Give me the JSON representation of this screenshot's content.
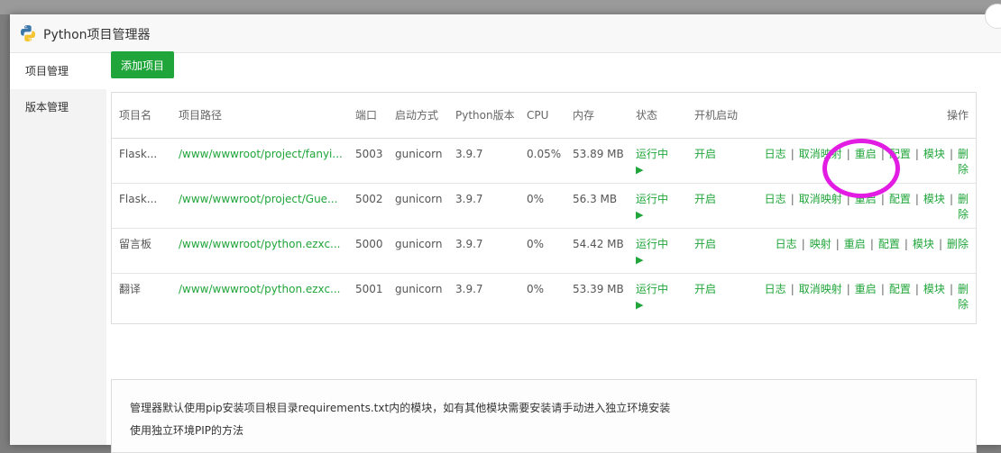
{
  "dialog": {
    "title": "Python项目管理器",
    "logo_icon": "python-logo-icon",
    "close_icon": "close-icon"
  },
  "sidebar": {
    "items": [
      {
        "label": "项目管理",
        "active": true
      },
      {
        "label": "版本管理",
        "active": false
      }
    ]
  },
  "toolbar": {
    "add_label": "添加项目"
  },
  "table": {
    "columns": [
      "项目名",
      "项目路径",
      "端口",
      "启动方式",
      "Python版本",
      "CPU",
      "内存",
      "状态",
      "开机启动",
      "操作"
    ],
    "rows": [
      {
        "name": "Flask...",
        "path": "/www/wwwroot/project/fanyi...",
        "port": "5003",
        "start": "gunicorn",
        "python": "3.9.7",
        "cpu": "0.05%",
        "mem": "53.89 MB",
        "status": "运行中",
        "status_icon": "play-icon",
        "boot": "开启",
        "actions": {
          "log": "日志",
          "map": "取消映射",
          "restart": "重启",
          "config": "配置",
          "module": "模块",
          "delete": "删除"
        }
      },
      {
        "name": "Flask...",
        "path": "/www/wwwroot/project/Gue...",
        "port": "5002",
        "start": "gunicorn",
        "python": "3.9.7",
        "cpu": "0%",
        "mem": "56.3 MB",
        "status": "运行中",
        "status_icon": "play-icon",
        "boot": "开启",
        "actions": {
          "log": "日志",
          "map": "取消映射",
          "restart": "重启",
          "config": "配置",
          "module": "模块",
          "delete": "删除"
        }
      },
      {
        "name": "留言板",
        "path": "/www/wwwroot/python.ezxc...",
        "port": "5000",
        "start": "gunicorn",
        "python": "3.9.7",
        "cpu": "0%",
        "mem": "54.42 MB",
        "status": "运行中",
        "status_icon": "play-icon",
        "boot": "开启",
        "actions": {
          "log": "日志",
          "map": "映射",
          "restart": "重启",
          "config": "配置",
          "module": "模块",
          "delete": "删除"
        }
      },
      {
        "name": "翻译",
        "path": "/www/wwwroot/python.ezxc...",
        "port": "5001",
        "start": "gunicorn",
        "python": "3.9.7",
        "cpu": "0%",
        "mem": "53.39 MB",
        "status": "运行中",
        "status_icon": "play-icon",
        "boot": "开启",
        "actions": {
          "log": "日志",
          "map": "取消映射",
          "restart": "重启",
          "config": "配置",
          "module": "模块",
          "delete": "删除"
        }
      }
    ],
    "separator": "|"
  },
  "notice": {
    "line1": "管理器默认使用pip安装项目根目录requirements.txt内的模块，如有其他模块需要安装请手动进入独立环境安装",
    "line2": "使用独立环境PIP的方法"
  },
  "colors": {
    "accent": "#20a53a",
    "annotation": "#e21ce2"
  }
}
